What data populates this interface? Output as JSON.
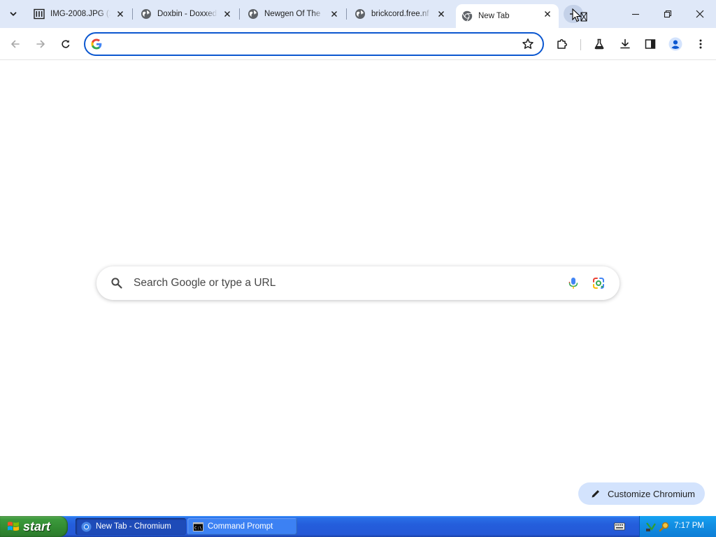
{
  "browser": {
    "tabs": [
      {
        "title": "IMG-2008.JPG (2",
        "icon": "image-favicon-icon",
        "active": false
      },
      {
        "title": "Doxbin - Doxxed",
        "icon": "globe-icon",
        "active": false
      },
      {
        "title": "Newgen Of The",
        "icon": "globe-icon",
        "active": false
      },
      {
        "title": "brickcord.free.nf",
        "icon": "globe-icon",
        "active": false
      },
      {
        "title": "New Tab",
        "icon": "chromium-icon",
        "active": true
      }
    ],
    "omnibox": {
      "value": "",
      "placeholder": ""
    }
  },
  "ntp": {
    "search_placeholder": "Search Google or type a URL",
    "customize_label": "Customize Chromium"
  },
  "taskbar": {
    "start_label": "start",
    "tasks": [
      {
        "label": "New Tab - Chromium",
        "icon": "chromium-icon",
        "active": true
      },
      {
        "label": "Command Prompt",
        "icon": "cmd-icon",
        "active": false
      }
    ],
    "clock": "7:17 PM"
  },
  "colors": {
    "tabstrip_bg": "#dfe8f8",
    "omnibox_focus": "#0b57d0",
    "customize_bg": "#d3e3fd",
    "taskbar_blue": "#245edc",
    "start_green": "#318a31"
  }
}
